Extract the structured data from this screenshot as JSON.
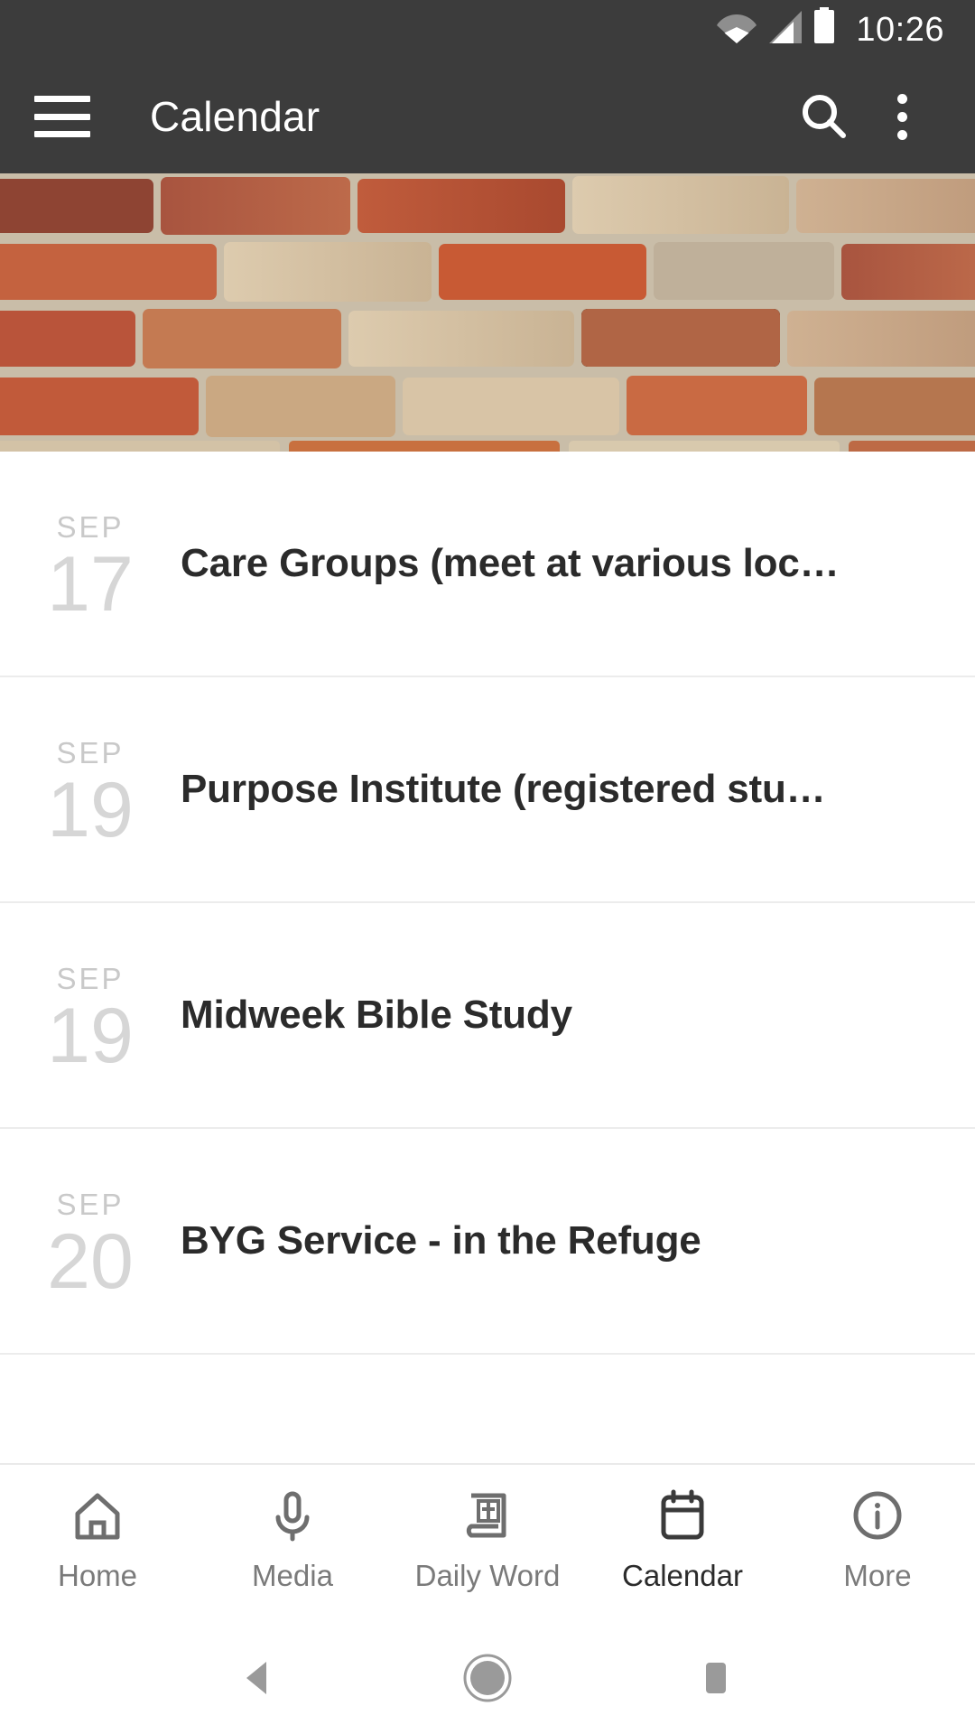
{
  "statusbar": {
    "time": "10:26",
    "icons": [
      "wifi-icon",
      "cellular-signal-icon",
      "battery-icon"
    ]
  },
  "appbar": {
    "menu_icon": "hamburger-menu-icon",
    "title": "Calendar",
    "search_icon": "search-icon",
    "overflow_icon": "overflow-menu-icon"
  },
  "hero": {
    "name": "brick-wall-banner",
    "colors": {
      "brick_red": "#b5503a",
      "brick_orange": "#c4613d",
      "brick_tan": "#c9ad8e",
      "brick_light": "#ddcbae",
      "mortar": "#cdc3b0",
      "brick_dark": "#8a4636"
    }
  },
  "events": [
    {
      "month": "SEP",
      "day": "17",
      "title": "Care Groups (meet at various loc…"
    },
    {
      "month": "SEP",
      "day": "19",
      "title": "Purpose Institute (registered stu…"
    },
    {
      "month": "SEP",
      "day": "19",
      "title": "Midweek Bible Study"
    },
    {
      "month": "SEP",
      "day": "20",
      "title": "BYG Service - in the Refuge"
    }
  ],
  "tabbar": {
    "active_index": 3,
    "active_color": "#2b2b2b",
    "inactive_color": "#7a7a7a",
    "items": [
      {
        "label": "Home",
        "icon": "home-icon"
      },
      {
        "label": "Media",
        "icon": "microphone-icon"
      },
      {
        "label": "Daily Word",
        "icon": "bible-book-cross-icon"
      },
      {
        "label": "Calendar",
        "icon": "calendar-icon"
      },
      {
        "label": "More",
        "icon": "info-circle-icon"
      }
    ]
  },
  "navbar": {
    "items": [
      {
        "name": "back-button",
        "icon": "triangle-back-icon"
      },
      {
        "name": "home-button",
        "icon": "circle-home-icon"
      },
      {
        "name": "recents-button",
        "icon": "square-recents-icon"
      }
    ]
  }
}
